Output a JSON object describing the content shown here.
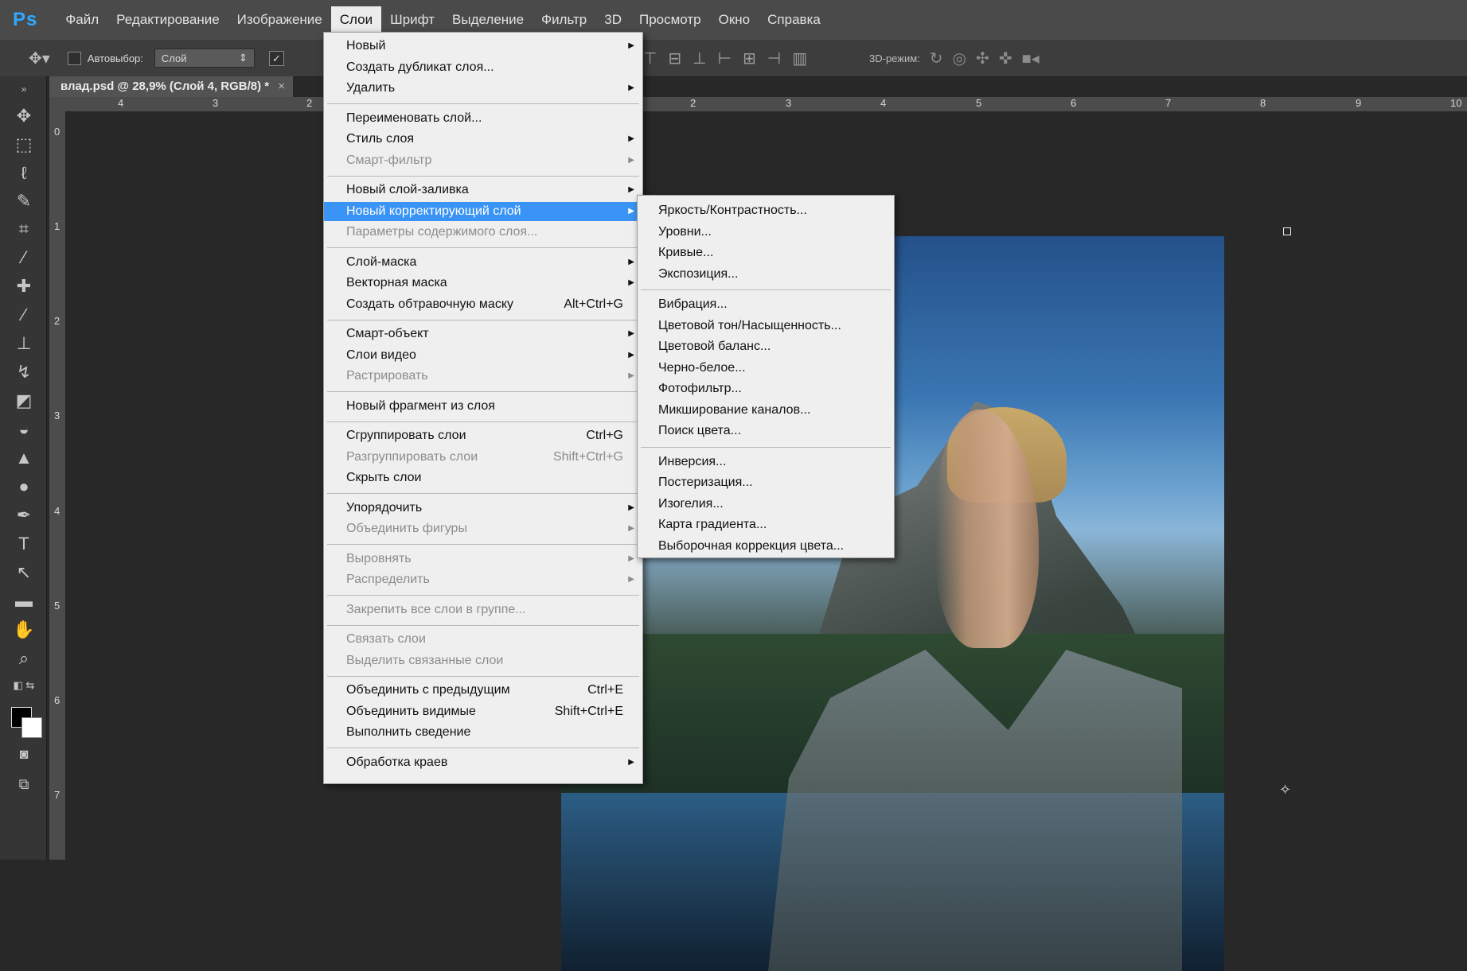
{
  "app": {
    "logo": "Ps",
    "menu": [
      "Файл",
      "Редактирование",
      "Изображение",
      "Слои",
      "Шрифт",
      "Выделение",
      "Фильтр",
      "3D",
      "Просмотр",
      "Окно",
      "Справка"
    ],
    "active_menu": "Слои"
  },
  "options": {
    "auto_select_label": "Автовыбор:",
    "auto_select_value": "Слой",
    "mode_3d_label": "3D-режим:"
  },
  "document": {
    "tab_title": "влад.psd @ 28,9% (Слой 4, RGB/8) *",
    "close_glyph": "×"
  },
  "rulers": {
    "top_labels": [
      "4",
      "3",
      "2",
      "2",
      "3",
      "4",
      "5",
      "6",
      "7",
      "8",
      "9",
      "10"
    ],
    "left_labels": [
      "0",
      "1",
      "2",
      "3",
      "4",
      "5",
      "6",
      "7"
    ]
  },
  "layer_menu": {
    "items": [
      {
        "label": "Новый",
        "submenu": true
      },
      {
        "label": "Создать дубликат слоя..."
      },
      {
        "label": "Удалить",
        "submenu": true
      },
      {
        "separator": true
      },
      {
        "label": "Переименовать слой..."
      },
      {
        "label": "Стиль слоя",
        "submenu": true
      },
      {
        "label": "Смарт-фильтр",
        "submenu": true,
        "disabled": true
      },
      {
        "separator": true
      },
      {
        "label": "Новый слой-заливка",
        "submenu": true
      },
      {
        "label": "Новый корректирующий слой",
        "submenu": true,
        "highlight": true
      },
      {
        "label": "Параметры содержимого слоя...",
        "disabled": true
      },
      {
        "separator": true
      },
      {
        "label": "Слой-маска",
        "submenu": true
      },
      {
        "label": "Векторная маска",
        "submenu": true
      },
      {
        "label": "Создать обтравочную маску",
        "shortcut": "Alt+Ctrl+G"
      },
      {
        "separator": true
      },
      {
        "label": "Смарт-объект",
        "submenu": true
      },
      {
        "label": "Слои видео",
        "submenu": true
      },
      {
        "label": "Растрировать",
        "submenu": true,
        "disabled": true
      },
      {
        "separator": true
      },
      {
        "label": "Новый фрагмент из слоя"
      },
      {
        "separator": true
      },
      {
        "label": "Сгруппировать слои",
        "shortcut": "Ctrl+G"
      },
      {
        "label": "Разгруппировать слои",
        "shortcut": "Shift+Ctrl+G",
        "disabled": true
      },
      {
        "label": "Скрыть слои"
      },
      {
        "separator": true
      },
      {
        "label": "Упорядочить",
        "submenu": true
      },
      {
        "label": "Объединить фигуры",
        "submenu": true,
        "disabled": true
      },
      {
        "separator": true
      },
      {
        "label": "Выровнять",
        "submenu": true,
        "disabled": true
      },
      {
        "label": "Распределить",
        "submenu": true,
        "disabled": true
      },
      {
        "separator": true
      },
      {
        "label": "Закрепить все слои в группе...",
        "disabled": true
      },
      {
        "separator": true
      },
      {
        "label": "Связать слои",
        "disabled": true
      },
      {
        "label": "Выделить связанные слои",
        "disabled": true
      },
      {
        "separator": true
      },
      {
        "label": "Объединить с предыдущим",
        "shortcut": "Ctrl+E"
      },
      {
        "label": "Объединить видимые",
        "shortcut": "Shift+Ctrl+E"
      },
      {
        "label": "Выполнить сведение"
      },
      {
        "separator": true
      },
      {
        "label": "Обработка краев",
        "submenu": true
      }
    ]
  },
  "adjustment_menu": {
    "items": [
      {
        "label": "Яркость/Контрастность..."
      },
      {
        "label": "Уровни..."
      },
      {
        "label": "Кривые..."
      },
      {
        "label": "Экспозиция..."
      },
      {
        "separator": true
      },
      {
        "label": "Вибрация..."
      },
      {
        "label": "Цветовой тон/Насыщенность..."
      },
      {
        "label": "Цветовой баланс..."
      },
      {
        "label": "Черно-белое..."
      },
      {
        "label": "Фотофильтр..."
      },
      {
        "label": "Микширование каналов..."
      },
      {
        "label": "Поиск цвета..."
      },
      {
        "separator": true
      },
      {
        "label": "Инверсия..."
      },
      {
        "label": "Постеризация..."
      },
      {
        "label": "Изогелия..."
      },
      {
        "label": "Карта градиента..."
      },
      {
        "label": "Выборочная коррекция цвета..."
      }
    ]
  },
  "colors": {
    "accent": "#3a94f6",
    "foreground": "#000000",
    "background": "#ffffff"
  }
}
